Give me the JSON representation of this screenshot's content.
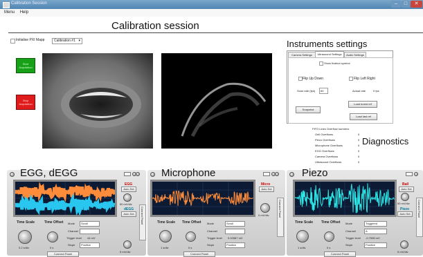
{
  "window": {
    "title": "Calibration Session",
    "controls": [
      "–",
      "□",
      "✕"
    ]
  },
  "menu": [
    "Menu",
    "Help"
  ],
  "top": {
    "title": "Calibration session",
    "checkbox_label": "Initialise PXI Mapp",
    "calibration_select": "Calibration #1",
    "start_button": "Start Acquisition",
    "stop_button": "Stop Acquisition"
  },
  "instruments": {
    "title": "Instruments settings",
    "tabs": [
      "Camera Settings",
      "Ultrasound Settings",
      "Audio Settings"
    ],
    "show_symbol": "Show fixation symbol",
    "flip_up_down": "Flip Up Down",
    "flip_left_right": "Flip Left Right",
    "scan_rate_label": "Scan rate (fps)",
    "scan_rate_value": "60",
    "actual_rate_label": "Actual rate",
    "actual_rate_value": "0 fps",
    "snapshot_button": "Snapshot",
    "load_tuned_button": "Load tuned ref",
    "load_last_button": "Load last ref"
  },
  "diagnostics": {
    "title": "Diagnostics",
    "header": "FIFO Lines Overflow numbers",
    "rows": [
      {
        "label": "Gell Overflows",
        "value": "0"
      },
      {
        "label": "Piezo Overflows",
        "value": "0"
      },
      {
        "label": "Microphone Overflows",
        "value": "0"
      },
      {
        "label": "EGG Overflows",
        "value": "0"
      },
      {
        "label": "Camera Overflows",
        "value": "0"
      },
      {
        "label": "Ultrasound Overflows",
        "value": "0"
      }
    ]
  },
  "panels": [
    {
      "title": "EGG, dEGG",
      "side_labels": [
        "EGG",
        "Auto Set",
        "dEGG",
        "Auto Set"
      ],
      "side_values": [
        "50 mV/div",
        "5 mV/div"
      ],
      "time_scale": "Time Scale",
      "time_offset": "Time Offset",
      "time_scale_value": "0.2 s/div",
      "time_offset_value": "0 s",
      "mode_label": "Mode",
      "mode_value": "Scroll",
      "channel_label": "Channel",
      "trigger_label": "Trigger level",
      "trigger_value": "44 mV",
      "slope_label": "Slope",
      "slope_value": "Positive",
      "connect_panel": "Connect Panel",
      "vertical_tab": "Connect Panel",
      "colors": [
        "#ff8c3a",
        "#29c7ef"
      ]
    },
    {
      "title": "Microphone",
      "side_labels": [
        "Micro",
        "Auto Set"
      ],
      "side_values": [
        "0 mV/div"
      ],
      "time_scale": "Time Scale",
      "time_offset": "Time Offset",
      "time_scale_value": "1 s/div",
      "time_offset_value": "0 s",
      "mode_label": "Mode",
      "mode_value": "Scroll",
      "channel_label": "Channel",
      "trigger_label": "Trigger level",
      "trigger_value": "0.02687 mV",
      "slope_label": "Slope",
      "slope_value": "Positive",
      "connect_panel": "Connect Panel",
      "vertical_tab": "Connect Panel",
      "colors": [
        "#ff8c3a"
      ]
    },
    {
      "title": "Piezo",
      "side_labels": [
        "Ball",
        "Auto Set",
        "Piezo",
        "Auto Set"
      ],
      "side_values": [
        "50 mV/div",
        "5 mV/div"
      ],
      "time_scale": "Time Scale",
      "time_offset": "Time Offset",
      "time_scale_value": "1 s/div",
      "time_offset_value": "0 s",
      "mode_label": "Mode",
      "mode_value": "Triggered",
      "channel_label": "Channel",
      "channel_value": "A",
      "trigger_label": "Trigger level",
      "trigger_value": "-0.7598 mV",
      "slope_label": "Slope",
      "slope_value": "Positive",
      "connect_panel": "Connect Panel",
      "vertical_tab": "Connect Panel",
      "colors": [
        "#2de8e8"
      ]
    }
  ]
}
